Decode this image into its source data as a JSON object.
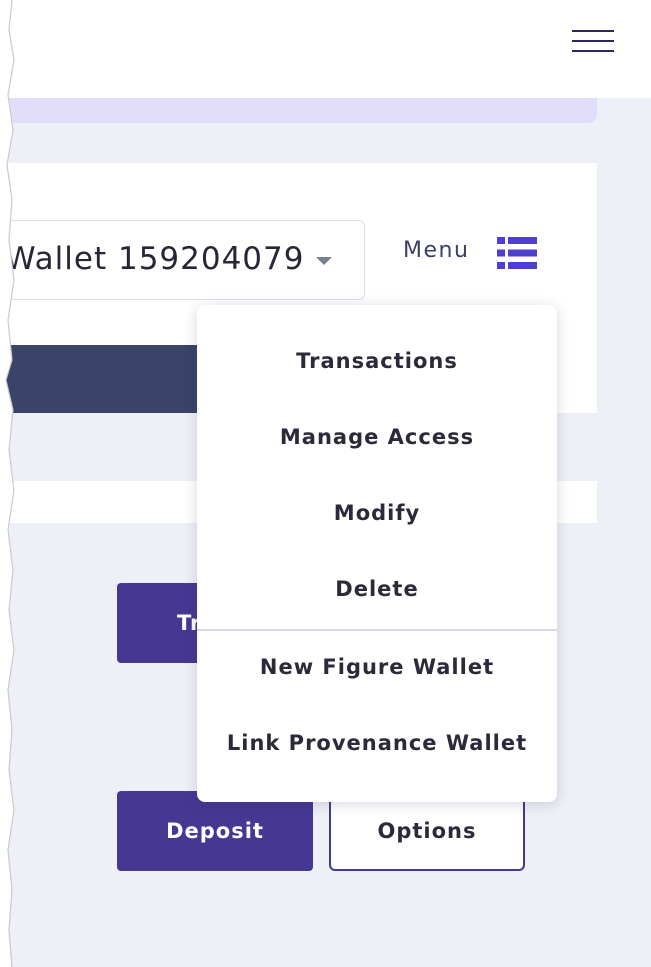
{
  "header": {
    "menu_icon": "hamburger-icon"
  },
  "wallet_selector": {
    "selected": "Wallet 159204079",
    "icon": "caret-down-icon"
  },
  "menu_toggle": {
    "label": "Menu",
    "icon": "list-icon"
  },
  "dropdown": {
    "items": [
      {
        "label": "Transactions"
      },
      {
        "label": "Manage Access"
      },
      {
        "label": "Modify"
      },
      {
        "label": "Delete"
      }
    ],
    "secondary_items": [
      {
        "label": "New Figure Wallet"
      },
      {
        "label": "Link Provenance Wallet"
      }
    ]
  },
  "actions": {
    "transfer_visible_label": "Tr",
    "deposit_label": "Deposit",
    "options_label": "Options"
  },
  "colors": {
    "accent": "#463892",
    "banner": "#e2defa",
    "dark_banner": "#3a4468",
    "background": "#eef0f7",
    "icon": "#4f3fd0"
  }
}
